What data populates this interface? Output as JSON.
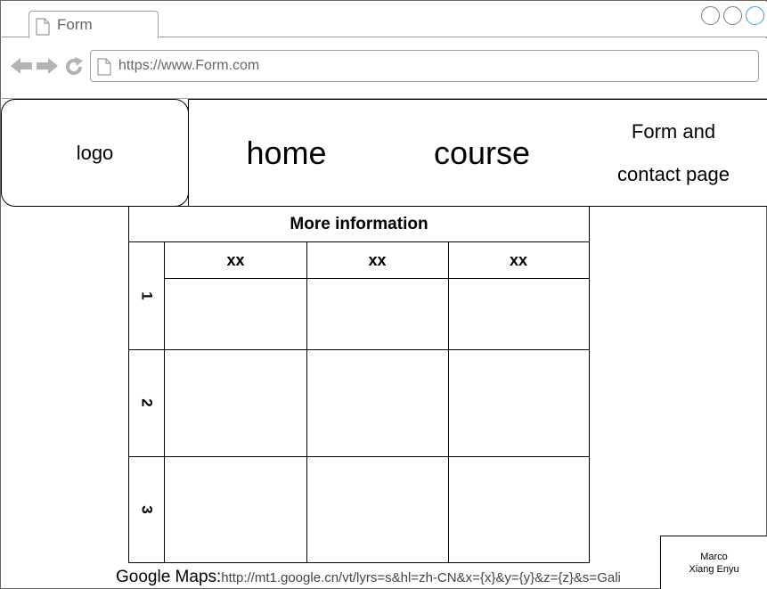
{
  "browser": {
    "tab_title": "Form",
    "url": "https://www.Form.com",
    "icons": {
      "back": "arrow-left-icon",
      "forward": "arrow-right-icon",
      "reload": "reload-icon",
      "page": "page-icon"
    }
  },
  "site_header": {
    "logo": "logo",
    "nav": {
      "home": "home",
      "course": "course",
      "form_line1": "Form and",
      "form_line2": "contact page"
    }
  },
  "table": {
    "title": "More information",
    "columns": [
      "xx",
      "xx",
      "xx"
    ],
    "rows": [
      "1",
      "2",
      "3"
    ]
  },
  "footer": {
    "maps_label": "Google Maps:",
    "maps_url": "http://mt1.google.cn/vt/lyrs=s&hl=zh-CN&x={x}&y={y}&z={z}&s=Gali",
    "credit_line1": "Marco",
    "credit_line2": "Xiang Enyu"
  },
  "colors": {
    "window_button_active": "#3fa1d8",
    "chrome_gray": "#a0a0a0"
  }
}
